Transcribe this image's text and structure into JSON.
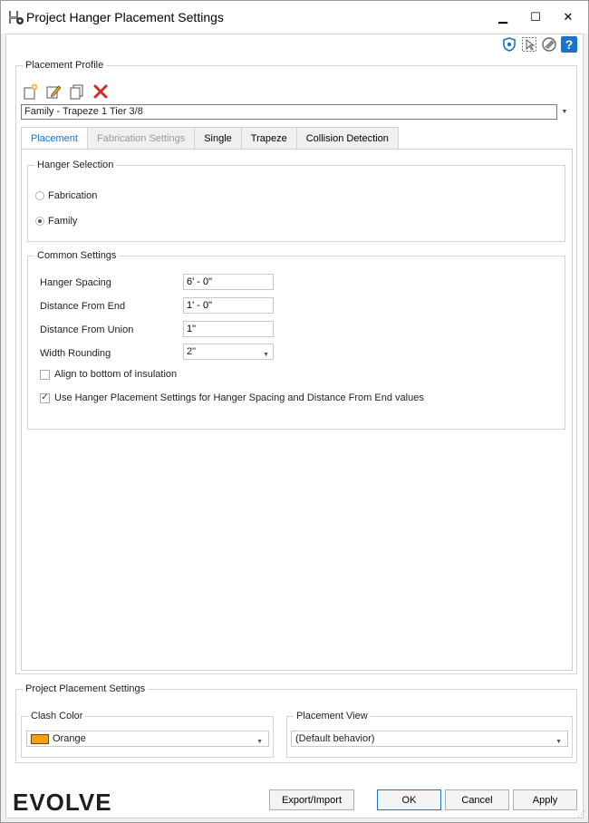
{
  "window": {
    "title": "Project Hanger Placement Settings",
    "minimize": "▁",
    "maximize": "☐",
    "close": "✕"
  },
  "placement_profile": {
    "legend": "Placement Profile",
    "selected": "Family - Trapeze 1 Tier 3/8"
  },
  "tabs": [
    {
      "label": "Placement"
    },
    {
      "label": "Fabrication Settings"
    },
    {
      "label": "Single"
    },
    {
      "label": "Trapeze"
    },
    {
      "label": "Collision Detection"
    }
  ],
  "hanger_selection": {
    "legend": "Hanger Selection",
    "options": [
      {
        "label": "Fabrication",
        "selected": false
      },
      {
        "label": "Family",
        "selected": true
      }
    ]
  },
  "common_settings": {
    "legend": "Common Settings",
    "fields": [
      {
        "label": "Hanger Spacing",
        "value": "6' - 0\""
      },
      {
        "label": "Distance From End",
        "value": "1' - 0\""
      },
      {
        "label": "Distance From Union",
        "value": "1\""
      },
      {
        "label": "Width Rounding",
        "value": "2\""
      }
    ],
    "align_bottom": {
      "label": "Align to bottom of insulation",
      "checked": false
    },
    "use_settings": {
      "label": "Use Hanger Placement Settings for Hanger Spacing and Distance From End values",
      "checked": true
    }
  },
  "project_placement": {
    "legend": "Project Placement Settings",
    "clash_color": {
      "legend": "Clash Color",
      "value": "Orange",
      "swatch": "#f5a10d"
    },
    "placement_view": {
      "legend": "Placement View",
      "value": "(Default behavior)"
    }
  },
  "footer": {
    "logo": "EVOLVE",
    "export_import": "Export/Import",
    "ok": "OK",
    "cancel": "Cancel",
    "apply": "Apply"
  },
  "colors": {
    "accent": "#1a74c9",
    "delete": "#d62a2a",
    "help": "#1a74c9"
  }
}
